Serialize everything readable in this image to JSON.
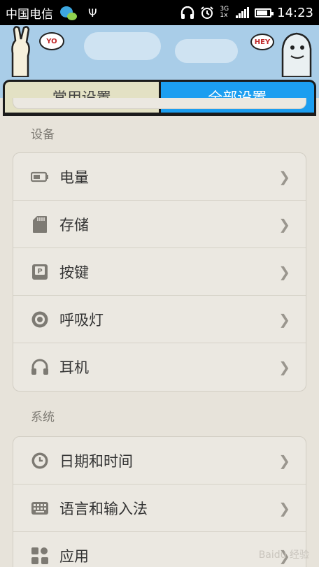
{
  "status_bar": {
    "carrier": "中国电信",
    "network_top": "3G",
    "network_bottom": "1x",
    "time": "14:23",
    "icons": [
      "qq-icon",
      "usb-icon",
      "headphones-icon",
      "alarm-icon",
      "signal-icon",
      "battery-icon"
    ]
  },
  "header": {
    "mascot_left_text": "YO",
    "mascot_right_text": "HEY",
    "tabs": [
      {
        "label": "常用设置",
        "active": false
      },
      {
        "label": "全部设置",
        "active": true
      }
    ],
    "active_color": "#1c9ef0"
  },
  "sections": [
    {
      "title": "设备",
      "items": [
        {
          "label": "电量",
          "icon": "battery-icon"
        },
        {
          "label": "存储",
          "icon": "sd-card-icon"
        },
        {
          "label": "按键",
          "icon": "key-icon"
        },
        {
          "label": "呼吸灯",
          "icon": "breathing-light-icon"
        },
        {
          "label": "耳机",
          "icon": "headphones-icon"
        }
      ]
    },
    {
      "title": "系统",
      "items": [
        {
          "label": "日期和时间",
          "icon": "clock-icon"
        },
        {
          "label": "语言和输入法",
          "icon": "keyboard-icon"
        },
        {
          "label": "应用",
          "icon": "apps-icon"
        }
      ]
    }
  ],
  "watermark": "Baidu 经验"
}
